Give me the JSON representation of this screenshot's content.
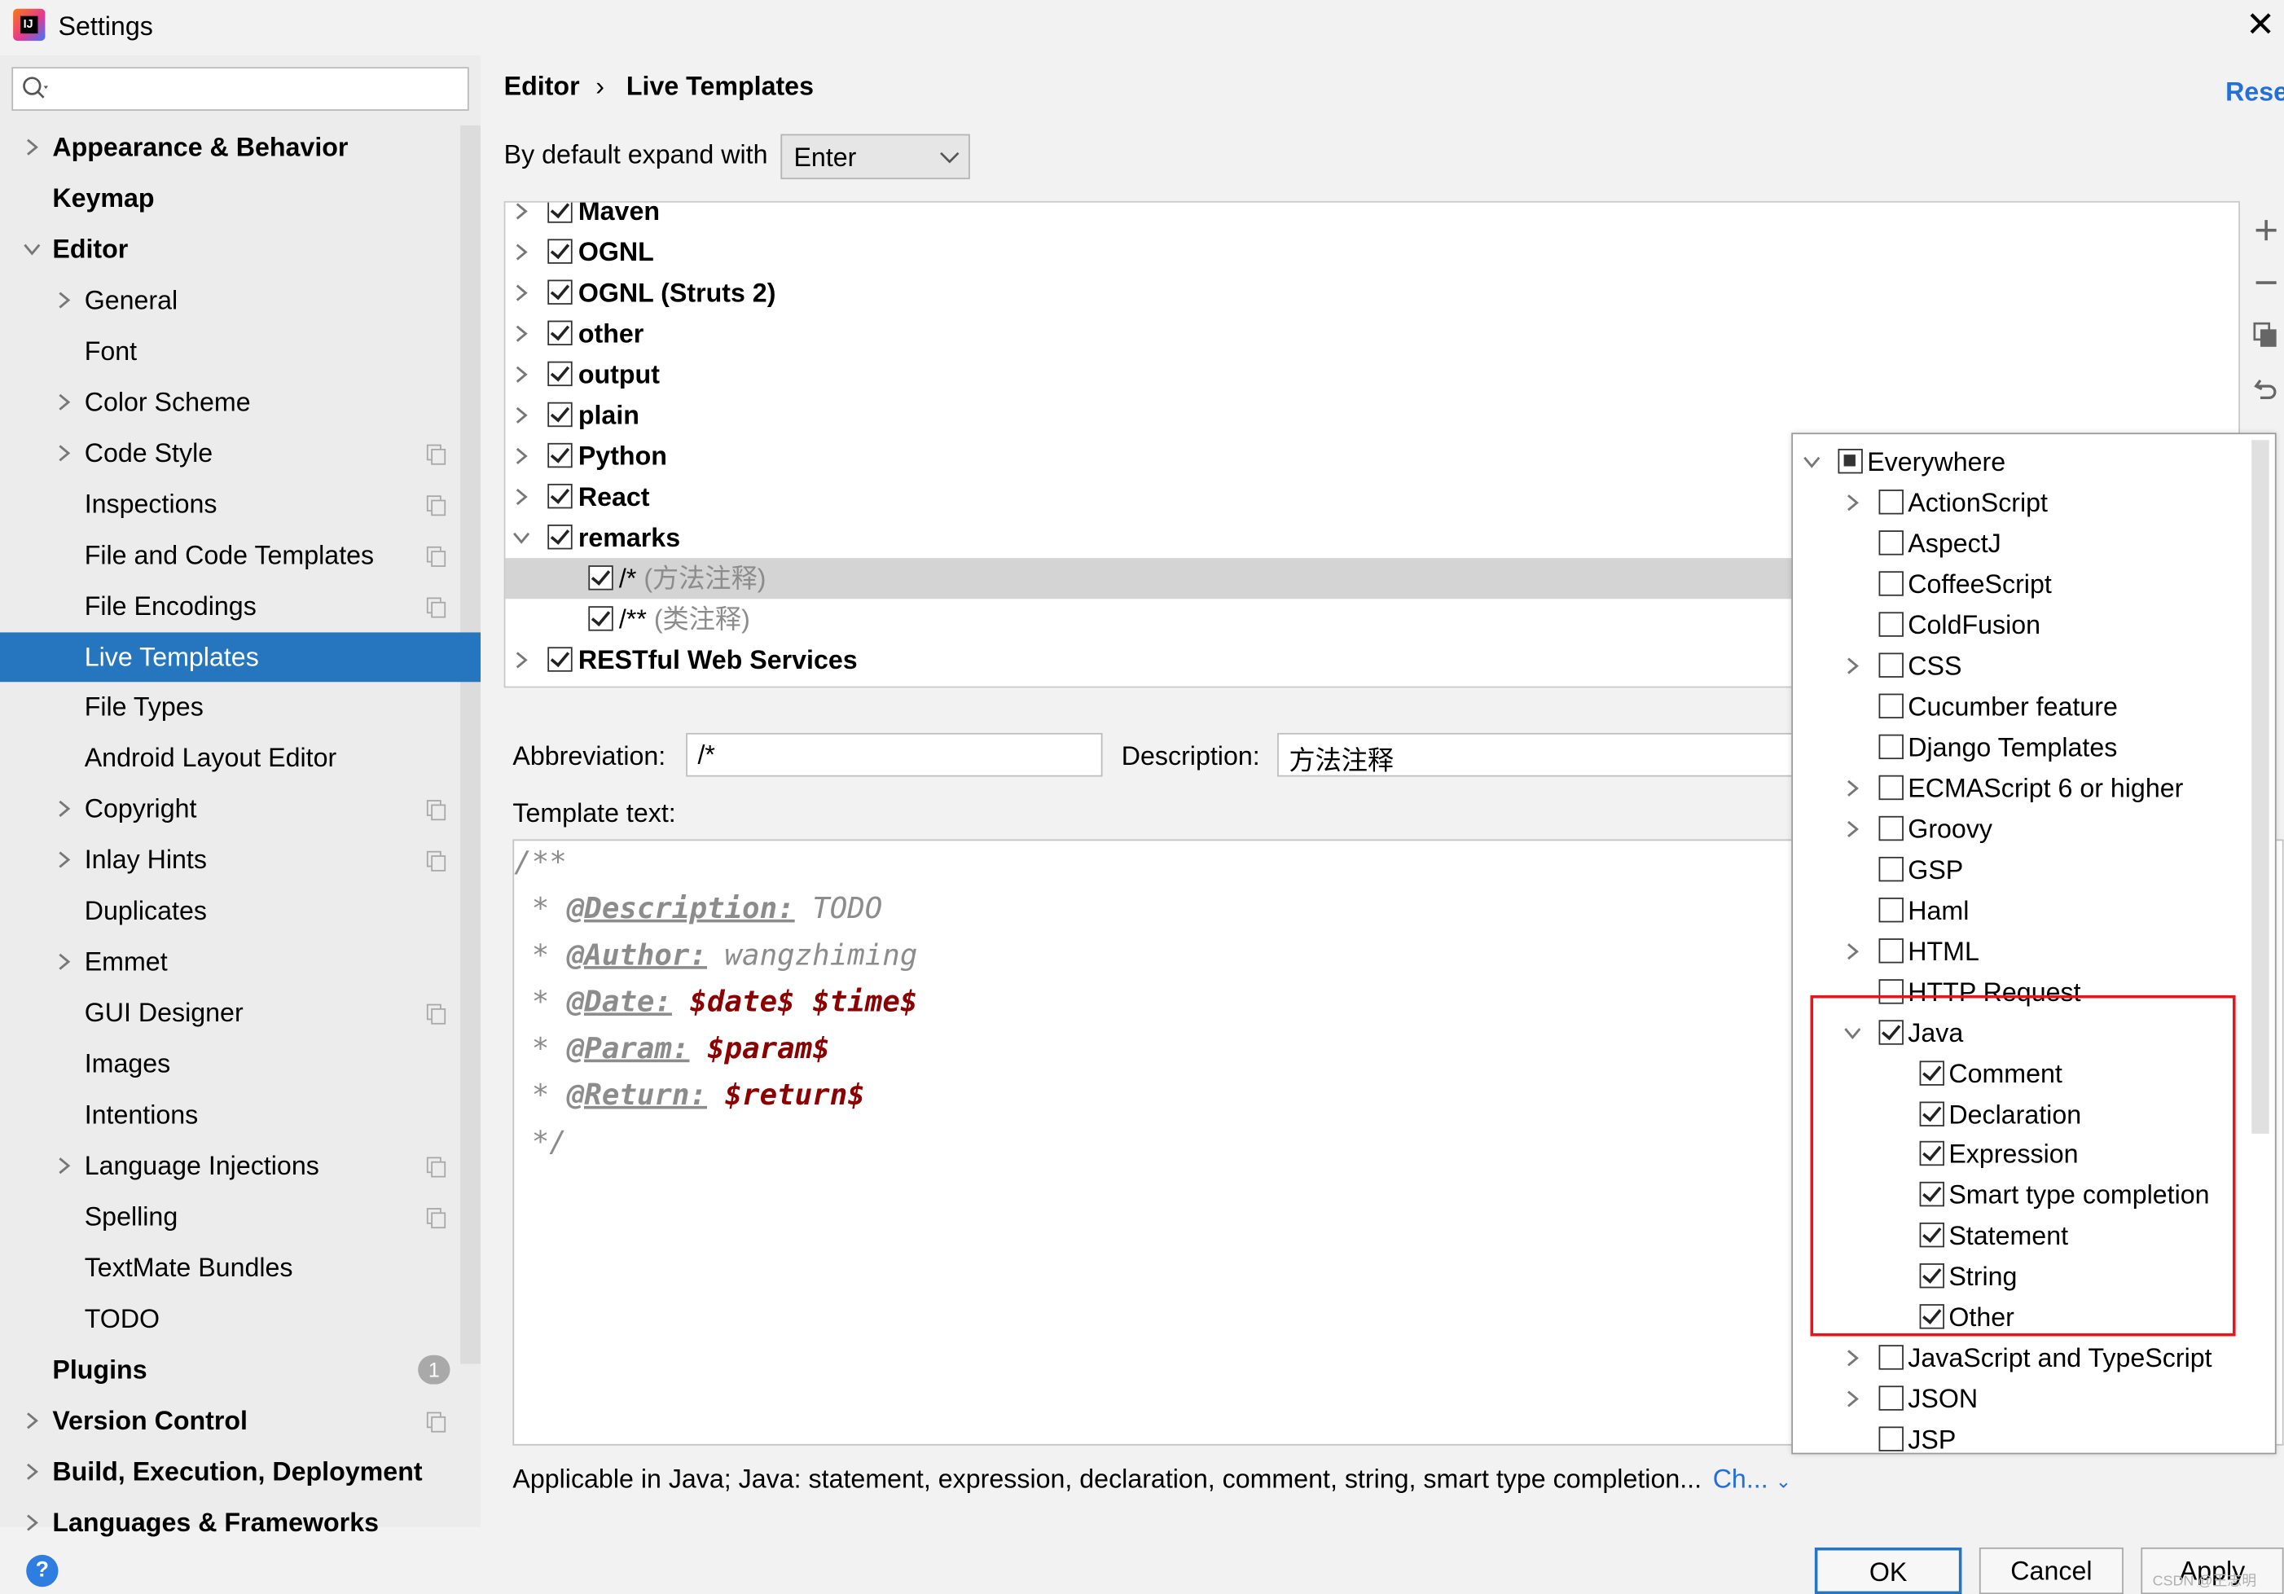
{
  "window": {
    "title": "Settings"
  },
  "search": {
    "placeholder": ""
  },
  "sidebar": {
    "items": [
      {
        "label": "Appearance & Behavior",
        "bold": true,
        "indent": 0,
        "chevron": "right",
        "copy": false
      },
      {
        "label": "Keymap",
        "bold": true,
        "indent": 0,
        "chevron": "",
        "copy": false
      },
      {
        "label": "Editor",
        "bold": true,
        "indent": 0,
        "chevron": "down",
        "copy": false
      },
      {
        "label": "General",
        "bold": false,
        "indent": 1,
        "chevron": "right",
        "copy": false
      },
      {
        "label": "Font",
        "bold": false,
        "indent": 1,
        "chevron": "",
        "copy": false
      },
      {
        "label": "Color Scheme",
        "bold": false,
        "indent": 1,
        "chevron": "right",
        "copy": false
      },
      {
        "label": "Code Style",
        "bold": false,
        "indent": 1,
        "chevron": "right",
        "copy": true
      },
      {
        "label": "Inspections",
        "bold": false,
        "indent": 1,
        "chevron": "",
        "copy": true
      },
      {
        "label": "File and Code Templates",
        "bold": false,
        "indent": 1,
        "chevron": "",
        "copy": true
      },
      {
        "label": "File Encodings",
        "bold": false,
        "indent": 1,
        "chevron": "",
        "copy": true
      },
      {
        "label": "Live Templates",
        "bold": false,
        "indent": 1,
        "chevron": "",
        "copy": false,
        "selected": true
      },
      {
        "label": "File Types",
        "bold": false,
        "indent": 1,
        "chevron": "",
        "copy": false
      },
      {
        "label": "Android Layout Editor",
        "bold": false,
        "indent": 1,
        "chevron": "",
        "copy": false
      },
      {
        "label": "Copyright",
        "bold": false,
        "indent": 1,
        "chevron": "right",
        "copy": true
      },
      {
        "label": "Inlay Hints",
        "bold": false,
        "indent": 1,
        "chevron": "right",
        "copy": true
      },
      {
        "label": "Duplicates",
        "bold": false,
        "indent": 1,
        "chevron": "",
        "copy": false
      },
      {
        "label": "Emmet",
        "bold": false,
        "indent": 1,
        "chevron": "right",
        "copy": false
      },
      {
        "label": "GUI Designer",
        "bold": false,
        "indent": 1,
        "chevron": "",
        "copy": true
      },
      {
        "label": "Images",
        "bold": false,
        "indent": 1,
        "chevron": "",
        "copy": false
      },
      {
        "label": "Intentions",
        "bold": false,
        "indent": 1,
        "chevron": "",
        "copy": false
      },
      {
        "label": "Language Injections",
        "bold": false,
        "indent": 1,
        "chevron": "right",
        "copy": true
      },
      {
        "label": "Spelling",
        "bold": false,
        "indent": 1,
        "chevron": "",
        "copy": true
      },
      {
        "label": "TextMate Bundles",
        "bold": false,
        "indent": 1,
        "chevron": "",
        "copy": false
      },
      {
        "label": "TODO",
        "bold": false,
        "indent": 1,
        "chevron": "",
        "copy": false
      },
      {
        "label": "Plugins",
        "bold": true,
        "indent": 0,
        "chevron": "",
        "copy": false,
        "badge": "1"
      },
      {
        "label": "Version Control",
        "bold": true,
        "indent": 0,
        "chevron": "right",
        "copy": true
      },
      {
        "label": "Build, Execution, Deployment",
        "bold": true,
        "indent": 0,
        "chevron": "right",
        "copy": false
      },
      {
        "label": "Languages & Frameworks",
        "bold": true,
        "indent": 0,
        "chevron": "right",
        "copy": false
      }
    ]
  },
  "breadcrumb": {
    "first": "Editor",
    "separator": "›",
    "second": "Live Templates"
  },
  "reset_label": "Rese",
  "expand": {
    "label": "By default expand with",
    "value": "Enter"
  },
  "templates": [
    {
      "label": "Maven",
      "group": true,
      "expanded": false,
      "checked": true
    },
    {
      "label": "OGNL",
      "group": true,
      "expanded": false,
      "checked": true
    },
    {
      "label": "OGNL (Struts 2)",
      "group": true,
      "expanded": false,
      "checked": true
    },
    {
      "label": "other",
      "group": true,
      "expanded": false,
      "checked": true
    },
    {
      "label": "output",
      "group": true,
      "expanded": false,
      "checked": true
    },
    {
      "label": "plain",
      "group": true,
      "expanded": false,
      "checked": true
    },
    {
      "label": "Python",
      "group": true,
      "expanded": false,
      "checked": true
    },
    {
      "label": "React",
      "group": true,
      "expanded": false,
      "checked": true
    },
    {
      "label": "remarks",
      "group": true,
      "expanded": true,
      "checked": true
    },
    {
      "label": "/*",
      "desc": " (方法注释)",
      "group": false,
      "checked": true,
      "selected": true
    },
    {
      "label": "/**",
      "desc": " (类注释)",
      "group": false,
      "checked": true
    },
    {
      "label": "RESTful Web Services",
      "group": true,
      "expanded": false,
      "checked": true
    }
  ],
  "abbreviation": {
    "label": "Abbreviation:",
    "value": "/*"
  },
  "description": {
    "label": "Description:",
    "value": "方法注释"
  },
  "template_text_label": "Template text:",
  "template_code": {
    "line1": "/**",
    "line2": {
      "star": " * ",
      "tag": "@Description:",
      "rest": " TODO"
    },
    "line3": {
      "star": " * ",
      "tag": "@Author:",
      "rest": " wangzhiming"
    },
    "line4": {
      "star": " * ",
      "tag": "@Date:",
      "v1": "$date$",
      "v2": "$time$"
    },
    "line5": {
      "star": " * ",
      "tag": "@Param:",
      "v1": "$param$"
    },
    "line6": {
      "star": " * ",
      "tag": "@Return:",
      "v1": "$return$"
    },
    "line7": " */"
  },
  "context_popup": [
    {
      "label": "Everywhere",
      "level": 0,
      "chevron": "down",
      "state": "partial"
    },
    {
      "label": "ActionScript",
      "level": 1,
      "chevron": "right",
      "state": "off"
    },
    {
      "label": "AspectJ",
      "level": 1,
      "chevron": "",
      "state": "off"
    },
    {
      "label": "CoffeeScript",
      "level": 1,
      "chevron": "",
      "state": "off"
    },
    {
      "label": "ColdFusion",
      "level": 1,
      "chevron": "",
      "state": "off"
    },
    {
      "label": "CSS",
      "level": 1,
      "chevron": "right",
      "state": "off"
    },
    {
      "label": "Cucumber feature",
      "level": 1,
      "chevron": "",
      "state": "off"
    },
    {
      "label": "Django Templates",
      "level": 1,
      "chevron": "",
      "state": "off"
    },
    {
      "label": "ECMAScript 6 or higher",
      "level": 1,
      "chevron": "right",
      "state": "off"
    },
    {
      "label": "Groovy",
      "level": 1,
      "chevron": "right",
      "state": "off"
    },
    {
      "label": "GSP",
      "level": 1,
      "chevron": "",
      "state": "off"
    },
    {
      "label": "Haml",
      "level": 1,
      "chevron": "",
      "state": "off"
    },
    {
      "label": "HTML",
      "level": 1,
      "chevron": "right",
      "state": "off"
    },
    {
      "label": "HTTP Request",
      "level": 1,
      "chevron": "",
      "state": "off"
    },
    {
      "label": "Java",
      "level": 1,
      "chevron": "down",
      "state": "on"
    },
    {
      "label": "Comment",
      "level": 2,
      "chevron": "",
      "state": "on"
    },
    {
      "label": "Declaration",
      "level": 2,
      "chevron": "",
      "state": "on"
    },
    {
      "label": "Expression",
      "level": 2,
      "chevron": "",
      "state": "on"
    },
    {
      "label": "Smart type completion",
      "level": 2,
      "chevron": "",
      "state": "on"
    },
    {
      "label": "Statement",
      "level": 2,
      "chevron": "",
      "state": "on"
    },
    {
      "label": "String",
      "level": 2,
      "chevron": "",
      "state": "on"
    },
    {
      "label": "Other",
      "level": 2,
      "chevron": "",
      "state": "on"
    },
    {
      "label": "JavaScript and TypeScript",
      "level": 1,
      "chevron": "right",
      "state": "off"
    },
    {
      "label": "JSON",
      "level": 1,
      "chevron": "right",
      "state": "off"
    },
    {
      "label": "JSP",
      "level": 1,
      "chevron": "",
      "state": "off"
    }
  ],
  "applicable_text": "Applicable in Java; Java: statement, expression, declaration, comment, string, smart type completion...",
  "change_link": "Ch...",
  "buttons": {
    "ok": "OK",
    "cancel": "Cancel",
    "apply": "Apply"
  },
  "help_label": "?",
  "watermark": "CSDN @王志明",
  "colors": {
    "accent": "#2675bf",
    "highlight_box": "#e8141c",
    "link": "#2470d8",
    "variable": "#8b0000"
  },
  "icons": [
    "app-logo-icon",
    "close-icon",
    "search-icon",
    "chevron-right-icon",
    "chevron-down-icon",
    "copy-icon",
    "add-icon",
    "remove-icon",
    "duplicate-icon",
    "restore-icon",
    "help-icon"
  ]
}
